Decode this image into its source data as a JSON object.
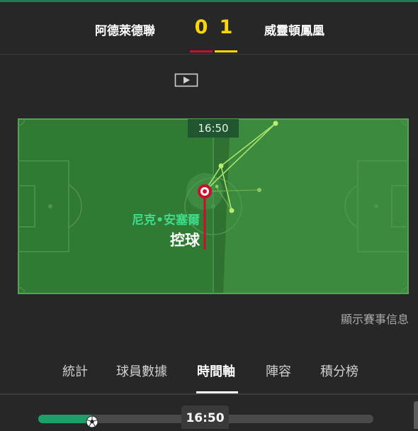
{
  "match": {
    "home_team": "阿德萊德聯",
    "away_team": "威靈頓鳳凰",
    "home_score": "0",
    "away_score": "1",
    "home_color": "#c8102e",
    "away_color": "#ffd500"
  },
  "view_toggle": {
    "items": [
      {
        "icon": "video-play-icon"
      },
      {
        "icon": "pitch-view-icon",
        "active": true
      }
    ]
  },
  "pitch": {
    "clock": "16:50",
    "player_name": "尼克•安塞爾",
    "action": "控球",
    "pitch_color": "#3c8a3e"
  },
  "info_link": "顯示賽事信息",
  "tabs": [
    {
      "label": "統計"
    },
    {
      "label": "球員數據"
    },
    {
      "label": "時間軸",
      "active": true
    },
    {
      "label": "陣容"
    },
    {
      "label": "積分榜"
    }
  ],
  "timeline": {
    "time": "16:50",
    "progress": 0.15
  }
}
